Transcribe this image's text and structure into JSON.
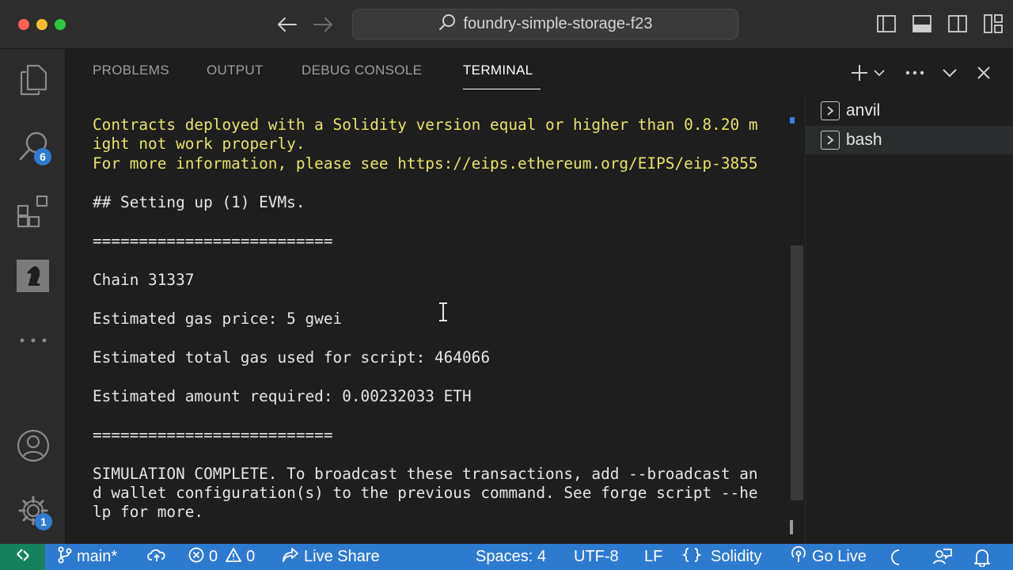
{
  "window": {
    "search_text": "foundry-simple-storage-f23"
  },
  "activity": {
    "search_badge": "6",
    "settings_badge": "1"
  },
  "panel": {
    "tabs": [
      {
        "label": "PROBLEMS"
      },
      {
        "label": "OUTPUT"
      },
      {
        "label": "DEBUG CONSOLE"
      },
      {
        "label": "TERMINAL"
      }
    ],
    "active_tab": "TERMINAL"
  },
  "terminal": {
    "lines": [
      "Contracts deployed with a Solidity version equal or higher than 0.8.20 m",
      "ight not work properly.",
      "For more information, please see https://eips.ethereum.org/EIPS/eip-3855",
      "## Setting up (1) EVMs.",
      "==========================",
      "Chain 31337",
      "Estimated gas price: 5 gwei",
      "Estimated total gas used for script: 464066",
      "Estimated amount required: 0.00232033 ETH",
      "==========================",
      "SIMULATION COMPLETE. To broadcast these transactions, add --broadcast an",
      "d wallet configuration(s) to the previous command. See forge script --he",
      "lp for more."
    ]
  },
  "terminal_list": [
    {
      "label": "anvil"
    },
    {
      "label": "bash"
    }
  ],
  "statusbar": {
    "branch": "main*",
    "errors": "0",
    "warnings": "0",
    "live_share": "Live Share",
    "spaces": "Spaces: 4",
    "encoding": "UTF-8",
    "eol": "LF",
    "language": "Solidity",
    "go_live": "Go Live"
  },
  "colors": {
    "statusbar": "#2f7ad1",
    "remote": "#16825d",
    "warning_text": "#e8e36a",
    "badge": "#2f7cd1"
  }
}
